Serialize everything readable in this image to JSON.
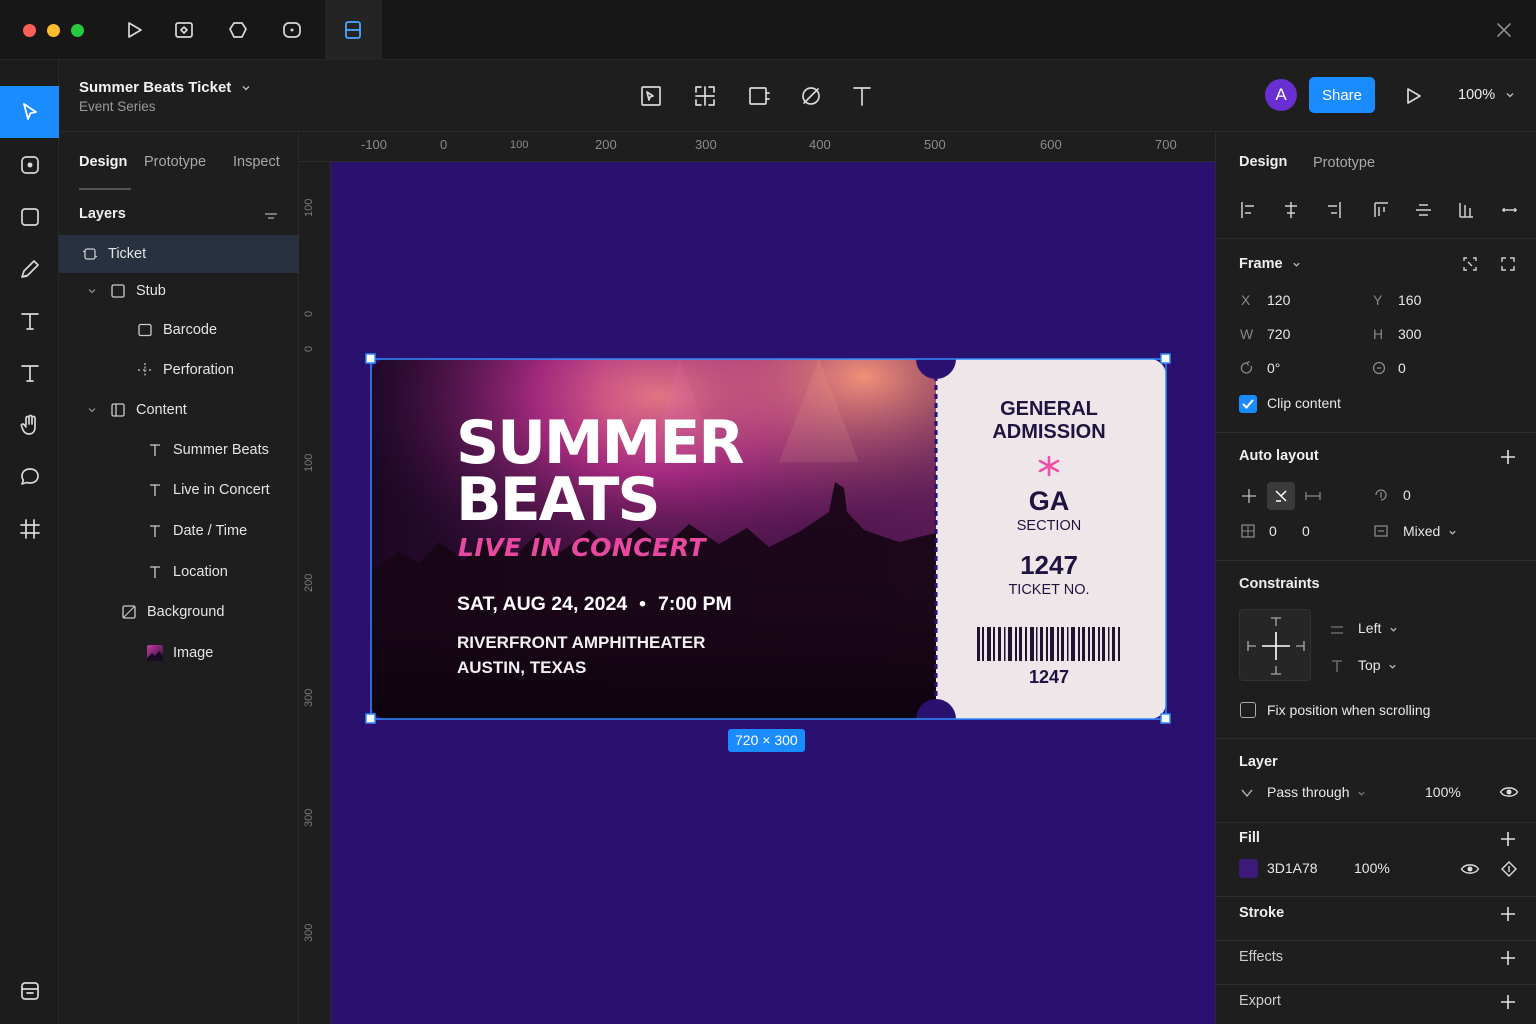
{
  "window": {
    "traffic_lights": {
      "close": "#ff5f57",
      "minimize": "#febc2e",
      "maximize": "#28c840"
    },
    "top_icons": [
      "play-icon",
      "component-icon",
      "plugin-icon",
      "comment-icon",
      "frame-icon"
    ],
    "close_icon": "close-icon"
  },
  "header": {
    "doc_title": "Summer Beats Ticket",
    "doc_subtitle": "Event Series",
    "avatar_initial": "A",
    "share_label": "Share",
    "zoom": "100%"
  },
  "left_panel": {
    "tabs": [
      "Design",
      "Prototype",
      "Inspect"
    ],
    "layers_title": "Layers",
    "layers": [
      {
        "name": "Ticket",
        "type": "frame",
        "selected": true
      },
      {
        "name": "Stub",
        "type": "group",
        "expanded": true
      },
      {
        "name": "Barcode",
        "type": "rectangle"
      },
      {
        "name": "Perforation",
        "type": "line"
      },
      {
        "name": "Content",
        "type": "group",
        "expanded": true
      },
      {
        "name": "Summer Beats",
        "type": "text"
      },
      {
        "name": "Live in Concert",
        "type": "text"
      },
      {
        "name": "Date / Time",
        "type": "text"
      },
      {
        "name": "Location",
        "type": "text"
      },
      {
        "name": "Background",
        "type": "frame"
      },
      {
        "name": "Image",
        "type": "image"
      }
    ]
  },
  "rulers": {
    "horizontal": [
      "-100",
      "0",
      "100",
      "200",
      "300",
      "400",
      "500",
      "600",
      "700"
    ],
    "vertical": [
      "100",
      "0",
      "0",
      "100",
      "200",
      "300",
      "300",
      "300"
    ]
  },
  "ticket": {
    "title_line1": "SUMMER",
    "title_line2": "BEATS",
    "tagline": "LIVE IN CONCERT",
    "date": "SAT, AUG 24, 2024",
    "time": "7:00 PM",
    "venue": "RIVERFRONT AMPHITHEATER",
    "city": "AUSTIN, TEXAS",
    "stub_heading_1": "GENERAL",
    "stub_heading_2": "ADMISSION",
    "section_value": "GA",
    "section_label": "SECTION",
    "ticket_number": "1247",
    "ticket_label": "TICKET NO.",
    "barcode_number": "1247",
    "size_badge": "720 × 300",
    "frame_color": "#3D1A78"
  },
  "right_panel": {
    "tabs": [
      "Design",
      "Prototype"
    ],
    "frame": {
      "title": "Frame",
      "x_label": "X",
      "x": "120",
      "y_label": "Y",
      "y": "160",
      "w_label": "W",
      "w": "720",
      "h_label": "H",
      "h": "300",
      "rotation": "0°",
      "radius": "0",
      "clip_content_label": "Clip content",
      "clip_content": true
    },
    "auto_layout": {
      "title": "Auto layout",
      "gap": "0",
      "pad_h": "0",
      "pad_v": "0",
      "align": "Mixed"
    },
    "constraints": {
      "title": "Constraints",
      "horizontal": "Left",
      "vertical": "Top",
      "fix_position_label": "Fix position when scrolling"
    },
    "layer": {
      "title": "Layer",
      "blend": "Pass through",
      "opacity": "100%"
    },
    "fill": {
      "title": "Fill",
      "hex": "3D1A78",
      "opacity": "100%",
      "swatch": "#3D1A78"
    },
    "stroke": {
      "title": "Stroke"
    },
    "effects": {
      "title": "Effects"
    },
    "export": {
      "title": "Export"
    }
  }
}
